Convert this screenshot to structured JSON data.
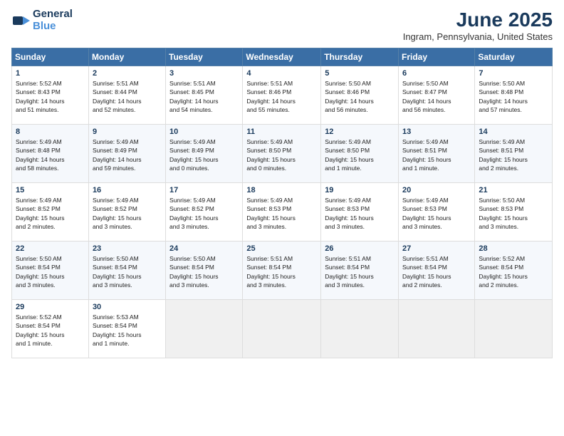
{
  "logo": {
    "line1": "General",
    "line2": "Blue"
  },
  "title": "June 2025",
  "subtitle": "Ingram, Pennsylvania, United States",
  "days_header": [
    "Sunday",
    "Monday",
    "Tuesday",
    "Wednesday",
    "Thursday",
    "Friday",
    "Saturday"
  ],
  "weeks": [
    [
      {
        "day": "1",
        "info": "Sunrise: 5:52 AM\nSunset: 8:43 PM\nDaylight: 14 hours\nand 51 minutes."
      },
      {
        "day": "2",
        "info": "Sunrise: 5:51 AM\nSunset: 8:44 PM\nDaylight: 14 hours\nand 52 minutes."
      },
      {
        "day": "3",
        "info": "Sunrise: 5:51 AM\nSunset: 8:45 PM\nDaylight: 14 hours\nand 54 minutes."
      },
      {
        "day": "4",
        "info": "Sunrise: 5:51 AM\nSunset: 8:46 PM\nDaylight: 14 hours\nand 55 minutes."
      },
      {
        "day": "5",
        "info": "Sunrise: 5:50 AM\nSunset: 8:46 PM\nDaylight: 14 hours\nand 56 minutes."
      },
      {
        "day": "6",
        "info": "Sunrise: 5:50 AM\nSunset: 8:47 PM\nDaylight: 14 hours\nand 56 minutes."
      },
      {
        "day": "7",
        "info": "Sunrise: 5:50 AM\nSunset: 8:48 PM\nDaylight: 14 hours\nand 57 minutes."
      }
    ],
    [
      {
        "day": "8",
        "info": "Sunrise: 5:49 AM\nSunset: 8:48 PM\nDaylight: 14 hours\nand 58 minutes."
      },
      {
        "day": "9",
        "info": "Sunrise: 5:49 AM\nSunset: 8:49 PM\nDaylight: 14 hours\nand 59 minutes."
      },
      {
        "day": "10",
        "info": "Sunrise: 5:49 AM\nSunset: 8:49 PM\nDaylight: 15 hours\nand 0 minutes."
      },
      {
        "day": "11",
        "info": "Sunrise: 5:49 AM\nSunset: 8:50 PM\nDaylight: 15 hours\nand 0 minutes."
      },
      {
        "day": "12",
        "info": "Sunrise: 5:49 AM\nSunset: 8:50 PM\nDaylight: 15 hours\nand 1 minute."
      },
      {
        "day": "13",
        "info": "Sunrise: 5:49 AM\nSunset: 8:51 PM\nDaylight: 15 hours\nand 1 minute."
      },
      {
        "day": "14",
        "info": "Sunrise: 5:49 AM\nSunset: 8:51 PM\nDaylight: 15 hours\nand 2 minutes."
      }
    ],
    [
      {
        "day": "15",
        "info": "Sunrise: 5:49 AM\nSunset: 8:52 PM\nDaylight: 15 hours\nand 2 minutes."
      },
      {
        "day": "16",
        "info": "Sunrise: 5:49 AM\nSunset: 8:52 PM\nDaylight: 15 hours\nand 3 minutes."
      },
      {
        "day": "17",
        "info": "Sunrise: 5:49 AM\nSunset: 8:52 PM\nDaylight: 15 hours\nand 3 minutes."
      },
      {
        "day": "18",
        "info": "Sunrise: 5:49 AM\nSunset: 8:53 PM\nDaylight: 15 hours\nand 3 minutes."
      },
      {
        "day": "19",
        "info": "Sunrise: 5:49 AM\nSunset: 8:53 PM\nDaylight: 15 hours\nand 3 minutes."
      },
      {
        "day": "20",
        "info": "Sunrise: 5:49 AM\nSunset: 8:53 PM\nDaylight: 15 hours\nand 3 minutes."
      },
      {
        "day": "21",
        "info": "Sunrise: 5:50 AM\nSunset: 8:53 PM\nDaylight: 15 hours\nand 3 minutes."
      }
    ],
    [
      {
        "day": "22",
        "info": "Sunrise: 5:50 AM\nSunset: 8:54 PM\nDaylight: 15 hours\nand 3 minutes."
      },
      {
        "day": "23",
        "info": "Sunrise: 5:50 AM\nSunset: 8:54 PM\nDaylight: 15 hours\nand 3 minutes."
      },
      {
        "day": "24",
        "info": "Sunrise: 5:50 AM\nSunset: 8:54 PM\nDaylight: 15 hours\nand 3 minutes."
      },
      {
        "day": "25",
        "info": "Sunrise: 5:51 AM\nSunset: 8:54 PM\nDaylight: 15 hours\nand 3 minutes."
      },
      {
        "day": "26",
        "info": "Sunrise: 5:51 AM\nSunset: 8:54 PM\nDaylight: 15 hours\nand 3 minutes."
      },
      {
        "day": "27",
        "info": "Sunrise: 5:51 AM\nSunset: 8:54 PM\nDaylight: 15 hours\nand 2 minutes."
      },
      {
        "day": "28",
        "info": "Sunrise: 5:52 AM\nSunset: 8:54 PM\nDaylight: 15 hours\nand 2 minutes."
      }
    ],
    [
      {
        "day": "29",
        "info": "Sunrise: 5:52 AM\nSunset: 8:54 PM\nDaylight: 15 hours\nand 1 minute."
      },
      {
        "day": "30",
        "info": "Sunrise: 5:53 AM\nSunset: 8:54 PM\nDaylight: 15 hours\nand 1 minute."
      },
      {
        "day": "",
        "info": ""
      },
      {
        "day": "",
        "info": ""
      },
      {
        "day": "",
        "info": ""
      },
      {
        "day": "",
        "info": ""
      },
      {
        "day": "",
        "info": ""
      }
    ]
  ]
}
